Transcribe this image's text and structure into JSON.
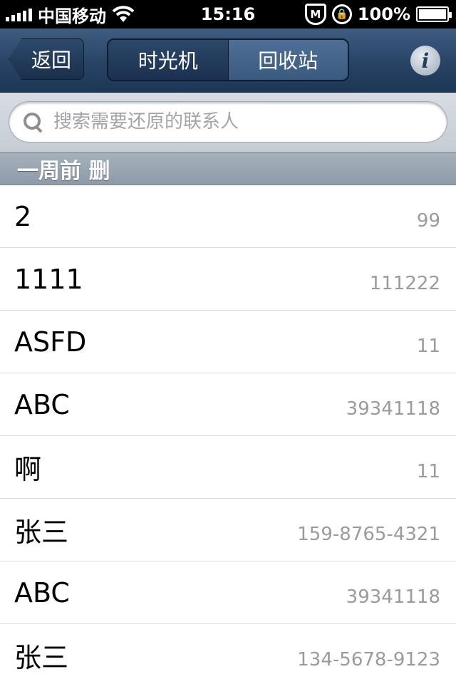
{
  "status_bar": {
    "carrier": "中国移动",
    "time": "15:16",
    "battery": "100%",
    "icons": [
      "signal-icon",
      "wifi-icon",
      "shield-m-icon",
      "rotation-lock-icon",
      "battery-icon"
    ]
  },
  "nav": {
    "back_label": "返回",
    "segments": [
      {
        "label": "时光机",
        "selected": false
      },
      {
        "label": "回收站",
        "selected": true
      }
    ],
    "info_label": "i"
  },
  "search": {
    "placeholder": "搜索需要还原的联系人",
    "value": ""
  },
  "section": {
    "title": "一周前 删"
  },
  "contacts": [
    {
      "name": "2",
      "number": "99"
    },
    {
      "name": "1111",
      "number": "111222"
    },
    {
      "name": "ASFD",
      "number": "11"
    },
    {
      "name": "ABC",
      "number": "39341118"
    },
    {
      "name": "啊",
      "number": "11"
    },
    {
      "name": "张三",
      "number": "159-8765-4321"
    },
    {
      "name": "ABC",
      "number": "39341118"
    },
    {
      "name": "张三",
      "number": "134-5678-9123"
    }
  ],
  "colors": {
    "nav_bar": "#2a4567",
    "segment_selected": "#4f6f96",
    "section_header": "#9aa5b2",
    "number_text": "#9b9b9b"
  }
}
